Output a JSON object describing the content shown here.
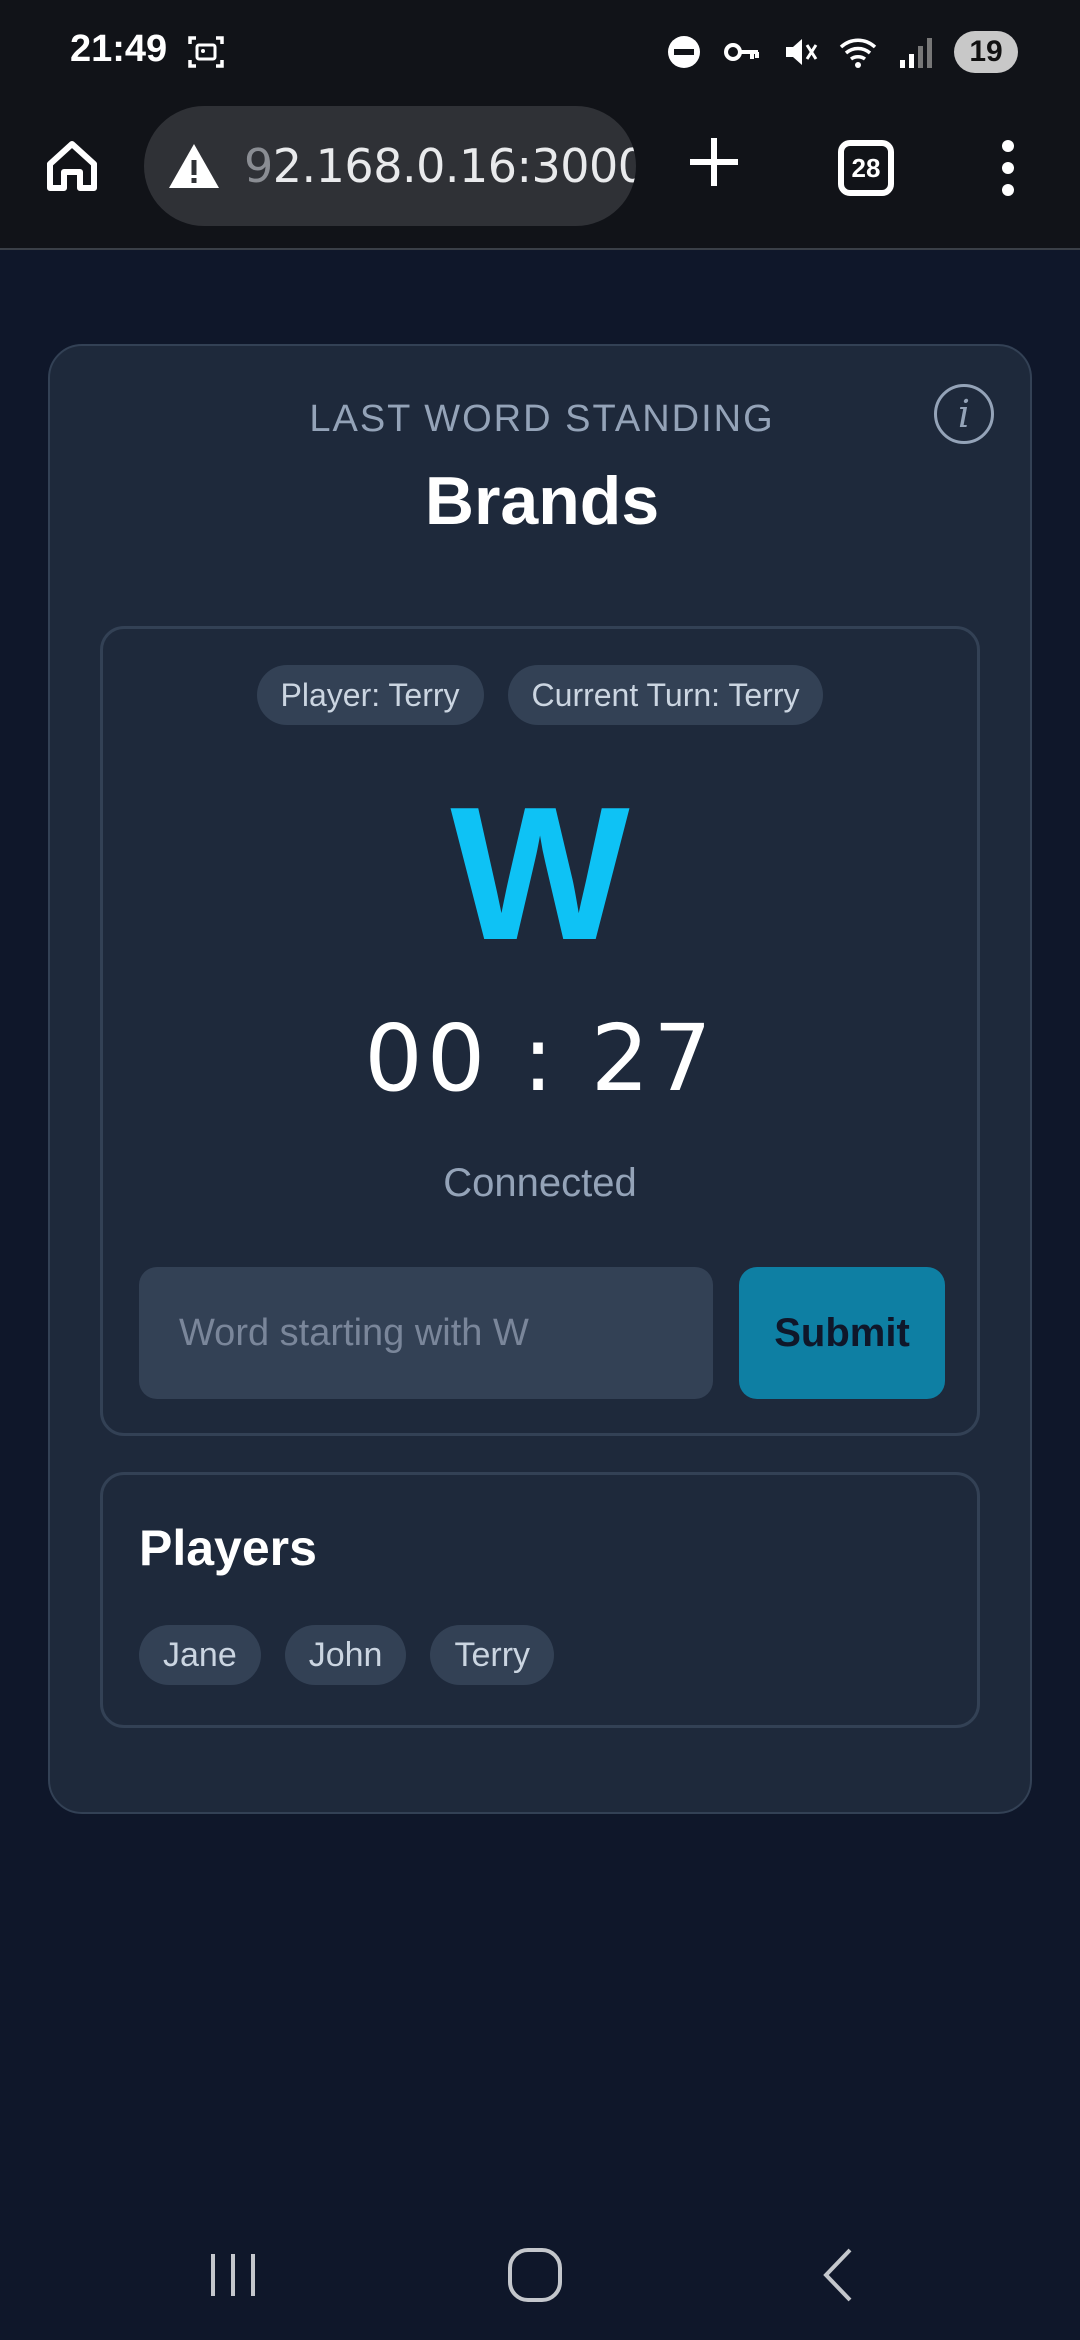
{
  "status_bar": {
    "time": "21:49",
    "battery": "19",
    "icons": [
      "screenshot-icon",
      "dnd-icon",
      "key-icon",
      "mute-icon",
      "wifi-icon",
      "signal-icon"
    ]
  },
  "browser": {
    "url_prefix": "9",
    "url_rest": "2.168.0.16:3000",
    "tab_count": "28",
    "icons": [
      "home-icon",
      "warning-icon",
      "plus-icon",
      "tabs-icon",
      "menu-icon"
    ]
  },
  "game": {
    "subtitle": "LAST WORD STANDING",
    "title": "Brands",
    "info_label": "i",
    "player_chip": "Player: Terry",
    "turn_chip": "Current Turn: Terry",
    "letter": "W",
    "timer": "00 : 27",
    "status": "Connected",
    "input_placeholder": "Word starting with W",
    "submit_label": "Submit"
  },
  "players": {
    "heading": "Players",
    "list": [
      "Jane",
      "John",
      "Terry"
    ]
  },
  "colors": {
    "background": "#0f172a",
    "card": "#1e293b",
    "accent": "#0ec2f5",
    "button": "#0e7fa3"
  }
}
